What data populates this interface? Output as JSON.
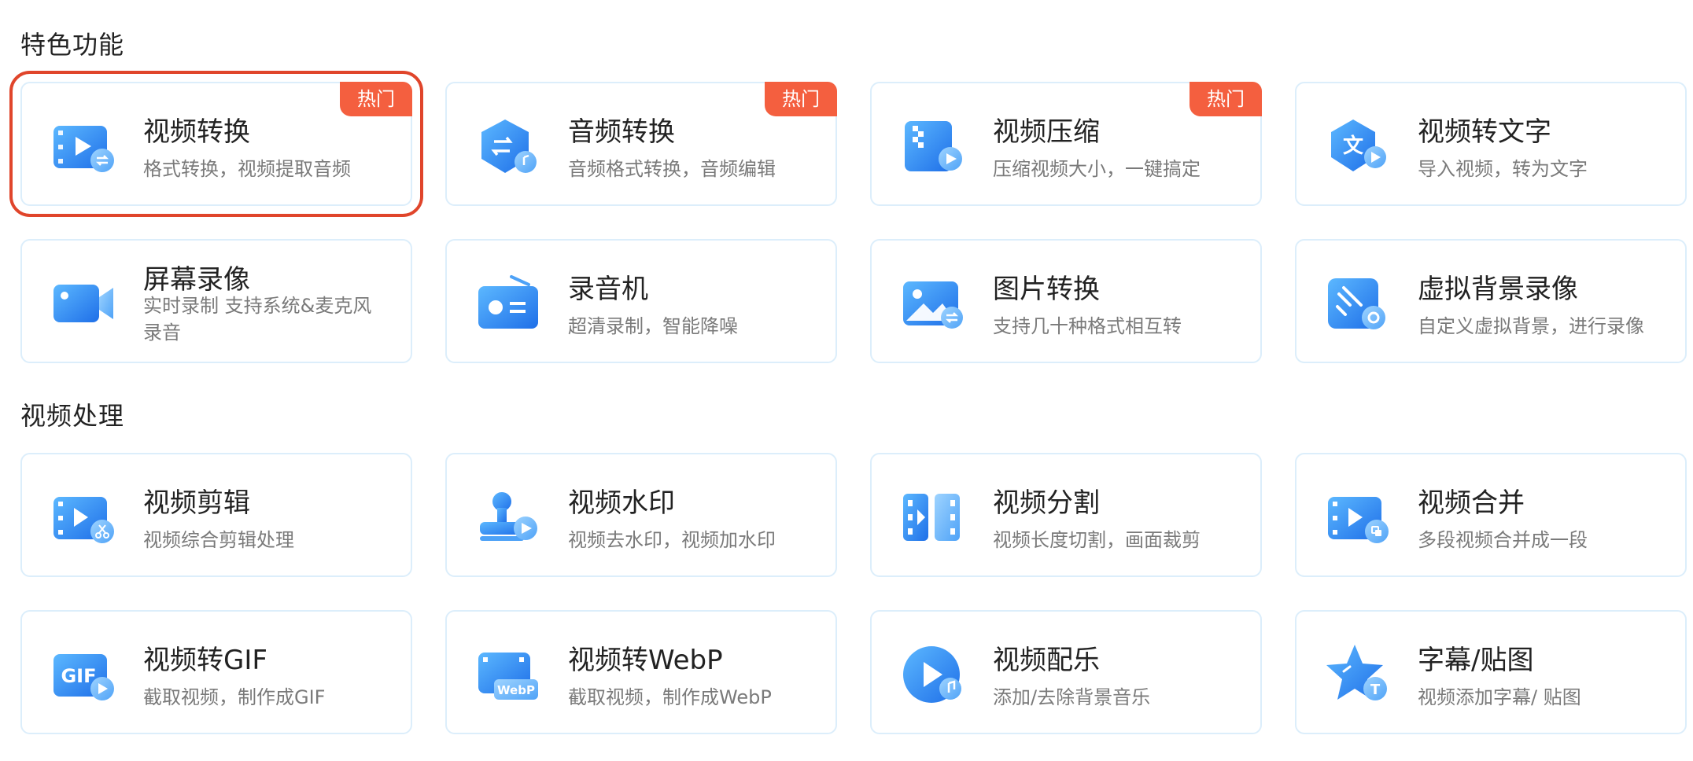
{
  "sections": [
    {
      "title": "特色功能",
      "cards": [
        {
          "title": "视频转换",
          "desc": "格式转换，视频提取音频",
          "badge": "热门",
          "icon": "video-convert-icon"
        },
        {
          "title": "音频转换",
          "desc": "音频格式转换，音频编辑",
          "badge": "热门",
          "icon": "audio-convert-icon"
        },
        {
          "title": "视频压缩",
          "desc": "压缩视频大小，一键搞定",
          "badge": "热门",
          "icon": "video-compress-icon"
        },
        {
          "title": "视频转文字",
          "desc": "导入视频，转为文字",
          "icon": "video-to-text-icon"
        },
        {
          "title": "屏幕录像",
          "desc": "实时录制 支持系统&麦克风录音",
          "icon": "screen-record-icon"
        },
        {
          "title": "录音机",
          "desc": "超清录制，智能降噪",
          "icon": "recorder-icon"
        },
        {
          "title": "图片转换",
          "desc": "支持几十种格式相互转",
          "icon": "image-convert-icon"
        },
        {
          "title": "虚拟背景录像",
          "desc": "自定义虚拟背景，进行录像",
          "icon": "virtual-background-icon"
        }
      ]
    },
    {
      "title": "视频处理",
      "cards": [
        {
          "title": "视频剪辑",
          "desc": "视频综合剪辑处理",
          "icon": "video-edit-icon"
        },
        {
          "title": "视频水印",
          "desc": "视频去水印，视频加水印",
          "icon": "video-watermark-icon"
        },
        {
          "title": "视频分割",
          "desc": "视频长度切割，画面裁剪",
          "icon": "video-split-icon"
        },
        {
          "title": "视频合并",
          "desc": "多段视频合并成一段",
          "icon": "video-merge-icon"
        },
        {
          "title": "视频转GIF",
          "desc": "截取视频，制作成GIF",
          "icon": "video-to-gif-icon",
          "icon_text": "GIF"
        },
        {
          "title": "视频转WebP",
          "desc": "截取视频，制作成WebP",
          "icon": "video-to-webp-icon",
          "icon_text": "WebP"
        },
        {
          "title": "视频配乐",
          "desc": "添加/去除背景音乐",
          "icon": "video-music-icon"
        },
        {
          "title": "字幕/贴图",
          "desc": "视频添加字幕/ 贴图",
          "icon": "subtitle-sticker-icon",
          "icon_text": "T"
        }
      ]
    }
  ],
  "selected_card": "视频转换",
  "colors": {
    "accent": "#2f8af5",
    "badge": "#f45f3f",
    "selection": "#e0452b",
    "card_border": "#dceefb"
  }
}
